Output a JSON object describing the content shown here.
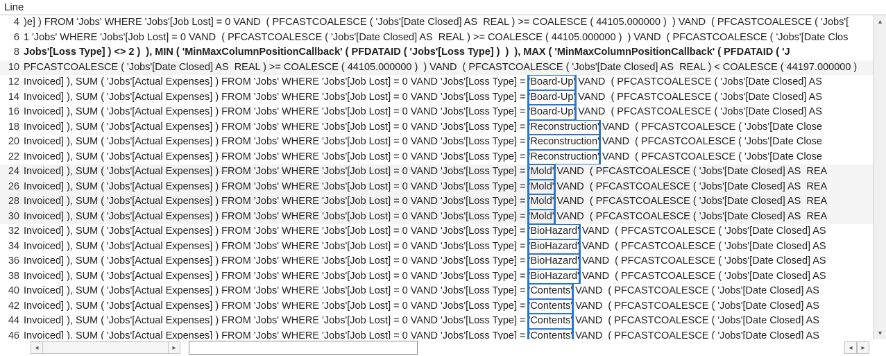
{
  "header": {
    "title": "Line"
  },
  "highlight_color": "#2e75c8",
  "rows": [
    {
      "line": 4,
      "bold": false,
      "alt": false,
      "seg": [
        {
          "t": ")e] ) FROM 'Jobs' WHERE 'Jobs'[Job Lost] = 0 VAND  ( PFCASTCOALESCE ( 'Jobs'[Date Closed] AS  REAL ) >= COALESCE ( 44105.000000 )  ) VAND  ( PFCASTCOALESCE ( 'Jobs'["
        }
      ]
    },
    {
      "line": 6,
      "bold": false,
      "alt": false,
      "seg": [
        {
          "t": "1 'Jobs' WHERE 'Jobs'[Job Lost] = 0 VAND  ( PFCASTCOALESCE ( 'Jobs'[Date Closed] AS  REAL ) >= COALESCE ( 44105.000000 )  ) VAND  ( PFCASTCOALESCE ( 'Jobs'[Date Clos"
        }
      ]
    },
    {
      "line": 8,
      "bold": true,
      "alt": false,
      "seg": [
        {
          "t": "Jobs'[Loss Type] ) <> 2 )  ), MIN ( 'MinMaxColumnPositionCallback' ( PFDATAID ( 'Jobs'[Loss Type] )  )  ), MAX ( 'MinMaxColumnPositionCallback' ( PFDATAID ( 'J"
        }
      ]
    },
    {
      "line": 10,
      "bold": false,
      "alt": true,
      "seg": [
        {
          "t": "PFCASTCOALESCE ( 'Jobs'[Date Closed] AS  REAL ) >= COALESCE ( 44105.000000 )  ) VAND  ( PFCASTCOALESCE ( 'Jobs'[Date Closed] AS  REAL ) < COALESCE ( 44197.000000 )"
        }
      ]
    },
    {
      "line": 12,
      "bold": false,
      "alt": false,
      "seg": [
        {
          "t": "Invoiced] ), SUM ( 'Jobs'[Actual Expenses] ) FROM 'Jobs' WHERE 'Jobs'[Job Lost] = 0 VAND 'Jobs'[Loss Type] = "
        },
        {
          "hl": true,
          "t": "'Board-Up'"
        },
        {
          "t": " VAND  ( PFCASTCOALESCE ( 'Jobs'[Date Closed] AS"
        }
      ]
    },
    {
      "line": 14,
      "bold": false,
      "alt": false,
      "seg": [
        {
          "t": "Invoiced] ), SUM ( 'Jobs'[Actual Expenses] ) FROM 'Jobs' WHERE 'Jobs'[Job Lost] = 0 VAND 'Jobs'[Loss Type] = "
        },
        {
          "hl": true,
          "t": "'Board-Up'"
        },
        {
          "t": " VAND  ( PFCASTCOALESCE ( 'Jobs'[Date Closed] AS"
        }
      ]
    },
    {
      "line": 16,
      "bold": false,
      "alt": false,
      "seg": [
        {
          "t": "Invoiced] ), SUM ( 'Jobs'[Actual Expenses] ) FROM 'Jobs' WHERE 'Jobs'[Job Lost] = 0 VAND 'Jobs'[Loss Type] = "
        },
        {
          "hl": true,
          "t": "'Board-Up'"
        },
        {
          "t": " VAND  ( PFCASTCOALESCE ( 'Jobs'[Date Closed] AS"
        }
      ]
    },
    {
      "line": 18,
      "bold": false,
      "alt": false,
      "seg": [
        {
          "t": "Invoiced] ), SUM ( 'Jobs'[Actual Expenses] ) FROM 'Jobs' WHERE 'Jobs'[Job Lost] = 0 VAND 'Jobs'[Loss Type] = "
        },
        {
          "hl": true,
          "t": "'Reconstruction'"
        },
        {
          "t": " VAND  ( PFCASTCOALESCE ( 'Jobs'[Date Close"
        }
      ]
    },
    {
      "line": 20,
      "bold": false,
      "alt": false,
      "seg": [
        {
          "t": "Invoiced] ), SUM ( 'Jobs'[Actual Expenses] ) FROM 'Jobs' WHERE 'Jobs'[Job Lost] = 0 VAND 'Jobs'[Loss Type] = "
        },
        {
          "hl": true,
          "t": "'Reconstruction'"
        },
        {
          "t": " VAND  ( PFCASTCOALESCE ( 'Jobs'[Date Close"
        }
      ]
    },
    {
      "line": 22,
      "bold": false,
      "alt": false,
      "seg": [
        {
          "t": "Invoiced] ), SUM ( 'Jobs'[Actual Expenses] ) FROM 'Jobs' WHERE 'Jobs'[Job Lost] = 0 VAND 'Jobs'[Loss Type] = "
        },
        {
          "hl": true,
          "t": "'Reconstruction'"
        },
        {
          "t": " VAND  ( PFCASTCOALESCE ( 'Jobs'[Date Close"
        }
      ]
    },
    {
      "line": 24,
      "bold": false,
      "alt": true,
      "seg": [
        {
          "t": "Invoiced] ), SUM ( 'Jobs'[Actual Expenses] ) FROM 'Jobs' WHERE 'Jobs'[Job Lost] = 0 VAND 'Jobs'[Loss Type] = "
        },
        {
          "hl": true,
          "t": "'Mold'"
        },
        {
          "t": " VAND  ( PFCASTCOALESCE ( 'Jobs'[Date Closed] AS  REA"
        }
      ]
    },
    {
      "line": 26,
      "bold": false,
      "alt": true,
      "seg": [
        {
          "t": "Invoiced] ), SUM ( 'Jobs'[Actual Expenses] ) FROM 'Jobs' WHERE 'Jobs'[Job Lost] = 0 VAND 'Jobs'[Loss Type] = "
        },
        {
          "hl": true,
          "t": "'Mold'"
        },
        {
          "t": " VAND  ( PFCASTCOALESCE ( 'Jobs'[Date Closed] AS  REA"
        }
      ]
    },
    {
      "line": 28,
      "bold": false,
      "alt": true,
      "seg": [
        {
          "t": "Invoiced] ), SUM ( 'Jobs'[Actual Expenses] ) FROM 'Jobs' WHERE 'Jobs'[Job Lost] = 0 VAND 'Jobs'[Loss Type] = "
        },
        {
          "hl": true,
          "t": "'Mold'"
        },
        {
          "t": " VAND  ( PFCASTCOALESCE ( 'Jobs'[Date Closed] AS  REA"
        }
      ]
    },
    {
      "line": 30,
      "bold": false,
      "alt": true,
      "seg": [
        {
          "t": "Invoiced] ), SUM ( 'Jobs'[Actual Expenses] ) FROM 'Jobs' WHERE 'Jobs'[Job Lost] = 0 VAND 'Jobs'[Loss Type] = "
        },
        {
          "hl": true,
          "t": "'Mold'"
        },
        {
          "t": " VAND  ( PFCASTCOALESCE ( 'Jobs'[Date Closed] AS  REA"
        }
      ]
    },
    {
      "line": 32,
      "bold": false,
      "alt": false,
      "seg": [
        {
          "t": "Invoiced] ), SUM ( 'Jobs'[Actual Expenses] ) FROM 'Jobs' WHERE 'Jobs'[Job Lost] = 0 VAND 'Jobs'[Loss Type] = "
        },
        {
          "hl": true,
          "t": "'BioHazard'"
        },
        {
          "t": " VAND  ( PFCASTCOALESCE ( 'Jobs'[Date Closed] AS"
        }
      ]
    },
    {
      "line": 34,
      "bold": false,
      "alt": false,
      "seg": [
        {
          "t": "Invoiced] ), SUM ( 'Jobs'[Actual Expenses] ) FROM 'Jobs' WHERE 'Jobs'[Job Lost] = 0 VAND 'Jobs'[Loss Type] = "
        },
        {
          "hl": true,
          "t": "'BioHazard'"
        },
        {
          "t": " VAND  ( PFCASTCOALESCE ( 'Jobs'[Date Closed] AS"
        }
      ]
    },
    {
      "line": 36,
      "bold": false,
      "alt": false,
      "seg": [
        {
          "t": "Invoiced] ), SUM ( 'Jobs'[Actual Expenses] ) FROM 'Jobs' WHERE 'Jobs'[Job Lost] = 0 VAND 'Jobs'[Loss Type] = "
        },
        {
          "hl": true,
          "t": "'BioHazard'"
        },
        {
          "t": " VAND  ( PFCASTCOALESCE ( 'Jobs'[Date Closed] AS"
        }
      ]
    },
    {
      "line": 38,
      "bold": false,
      "alt": false,
      "seg": [
        {
          "t": "Invoiced] ), SUM ( 'Jobs'[Actual Expenses] ) FROM 'Jobs' WHERE 'Jobs'[Job Lost] = 0 VAND 'Jobs'[Loss Type] = "
        },
        {
          "hl": true,
          "t": "'BioHazard'"
        },
        {
          "t": " VAND  ( PFCASTCOALESCE ( 'Jobs'[Date Closed] AS"
        }
      ]
    },
    {
      "line": 40,
      "bold": false,
      "alt": false,
      "seg": [
        {
          "t": "Invoiced] ), SUM ( 'Jobs'[Actual Expenses] ) FROM 'Jobs' WHERE 'Jobs'[Job Lost] = 0 VAND 'Jobs'[Loss Type] = "
        },
        {
          "hl": true,
          "t": "'Contents'"
        },
        {
          "t": " VAND  ( PFCASTCOALESCE ( 'Jobs'[Date Closed] AS"
        }
      ]
    },
    {
      "line": 42,
      "bold": false,
      "alt": false,
      "seg": [
        {
          "t": "Invoiced] ), SUM ( 'Jobs'[Actual Expenses] ) FROM 'Jobs' WHERE 'Jobs'[Job Lost] = 0 VAND 'Jobs'[Loss Type] = "
        },
        {
          "hl": true,
          "t": "'Contents'"
        },
        {
          "t": " VAND  ( PFCASTCOALESCE ( 'Jobs'[Date Closed] AS"
        }
      ]
    },
    {
      "line": 44,
      "bold": false,
      "alt": false,
      "seg": [
        {
          "t": "Invoiced] ), SUM ( 'Jobs'[Actual Expenses] ) FROM 'Jobs' WHERE 'Jobs'[Job Lost] = 0 VAND 'Jobs'[Loss Type] = "
        },
        {
          "hl": true,
          "t": "'Contents'"
        },
        {
          "t": " VAND  ( PFCASTCOALESCE ( 'Jobs'[Date Closed] AS"
        }
      ]
    },
    {
      "line": 46,
      "bold": false,
      "alt": false,
      "seg": [
        {
          "t": "Invoiced] ). SUM ( 'Jobs'[Actual Expenses] ) FROM 'Jobs' WHERE 'Jobs'[Job Lost] = 0 VAND 'Jobs'[Loss Type] = "
        },
        {
          "hl": true,
          "t": "'Contents'"
        },
        {
          "t": " VAND  ( PFCASTCOALESCE ( 'Jobs'[Date Closed] AS"
        }
      ]
    }
  ],
  "scroll": {
    "v_up": "▴",
    "v_down": "▾",
    "h_left": "◂",
    "h_right": "▸"
  },
  "input_value": ""
}
